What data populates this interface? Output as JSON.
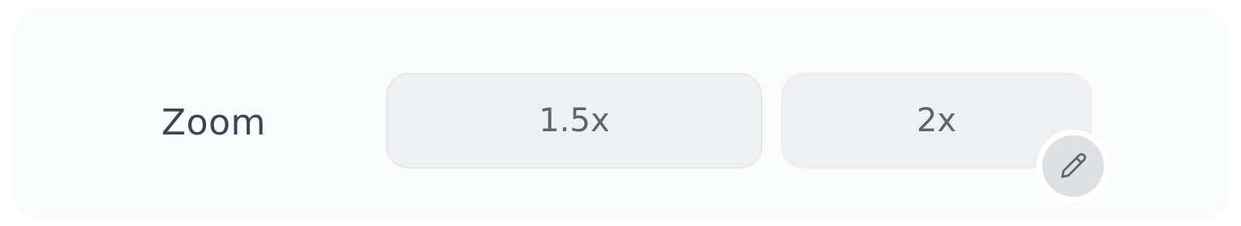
{
  "zoom": {
    "label": "Zoom",
    "options": [
      {
        "label": "1.5x"
      },
      {
        "label": "2x"
      }
    ],
    "edit_icon": "pencil-icon"
  },
  "colors": {
    "panel_background": "#fafbfb",
    "option_background": "#eff0f2",
    "label_text": "#3f4452",
    "option_text": "#60646f",
    "edit_button_background": "#dfe0e4",
    "icon_stroke": "#5d6170"
  }
}
